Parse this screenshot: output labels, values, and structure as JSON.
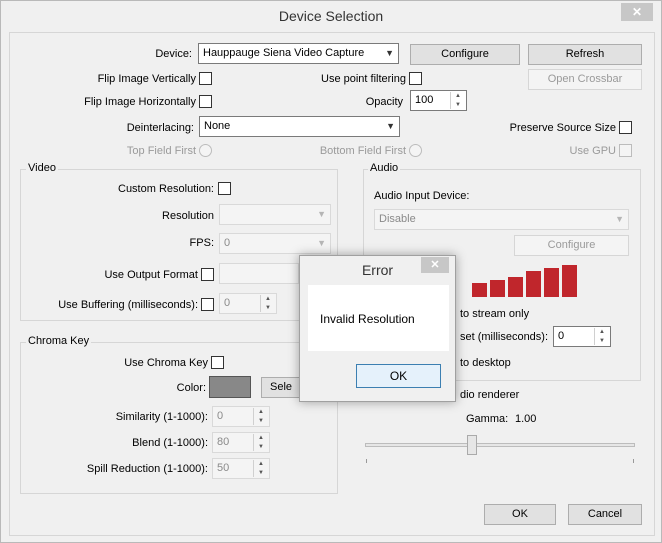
{
  "window": {
    "title": "Device Selection",
    "close_symbol": "✕"
  },
  "device": {
    "label": "Device:",
    "selected": "Hauppauge Siena Video Capture",
    "configure": "Configure",
    "refresh": "Refresh",
    "open_crossbar": "Open Crossbar"
  },
  "options": {
    "flip_vertical": "Flip Image Vertically",
    "flip_horizontal": "Flip Image Horizontally",
    "use_point_filtering": "Use point filtering",
    "opacity_label": "Opacity",
    "opacity_value": "100",
    "deinterlacing_label": "Deinterlacing:",
    "deinterlacing_value": "None",
    "preserve_source_size": "Preserve Source Size",
    "top_field_first": "Top Field First",
    "bottom_field_first": "Bottom Field First",
    "use_gpu": "Use GPU"
  },
  "video": {
    "title": "Video",
    "custom_resolution": "Custom Resolution:",
    "resolution_label": "Resolution",
    "resolution_value": "",
    "fps_label": "FPS:",
    "fps_value": "0",
    "use_output_format": "Use Output Format",
    "use_buffering": "Use Buffering (milliseconds):",
    "buffering_value": "0"
  },
  "chroma": {
    "title": "Chroma Key",
    "use_chroma_key": "Use Chroma Key",
    "color_label": "Color:",
    "color_value": "#888888",
    "select_button": "Sele",
    "similarity_label": "Similarity (1-1000):",
    "similarity_value": "0",
    "blend_label": "Blend (1-1000):",
    "blend_value": "80",
    "spill_label": "Spill Reduction (1-1000):",
    "spill_value": "50"
  },
  "audio": {
    "title": "Audio",
    "input_device_label": "Audio Input Device:",
    "input_device_value": "Disable",
    "configure": "Configure",
    "stream_only_partial": "to stream only",
    "offset_partial": "set (milliseconds):",
    "offset_value": "0",
    "desktop_partial": "to desktop",
    "renderer_partial": "dio renderer",
    "gamma_label": "Gamma:",
    "gamma_value": "1.00",
    "meter_color": "#c0262c",
    "meter_levels": [
      0.4,
      0.5,
      0.6,
      0.75,
      0.85,
      0.95
    ]
  },
  "footer": {
    "ok": "OK",
    "cancel": "Cancel"
  },
  "error_dialog": {
    "title": "Error",
    "close_symbol": "✕",
    "message": "Invalid Resolution",
    "ok": "OK"
  }
}
